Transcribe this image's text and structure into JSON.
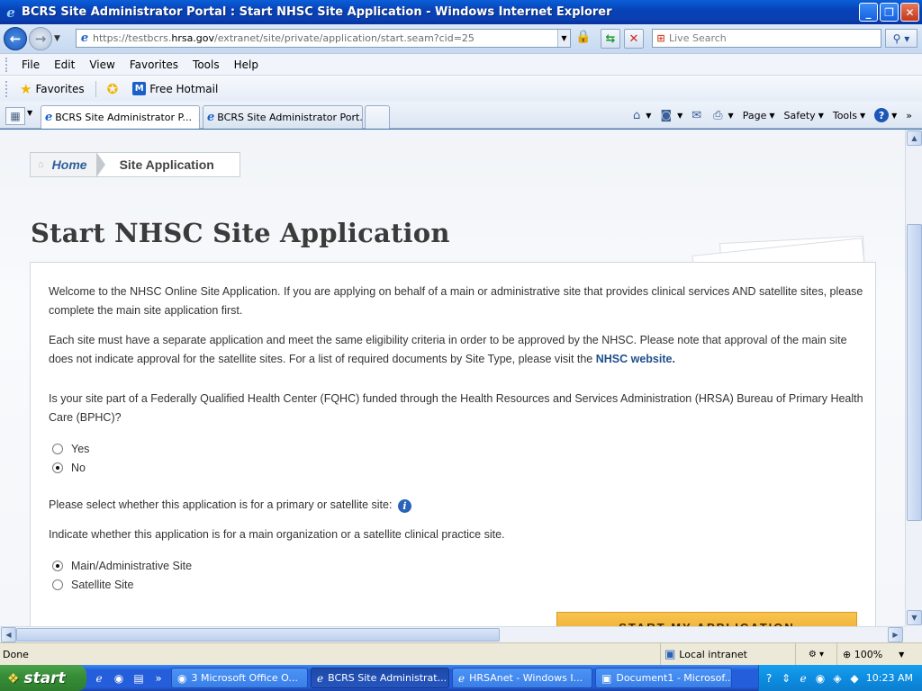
{
  "window": {
    "title": "BCRS Site Administrator Portal : Start NHSC Site Application - Windows Internet Explorer",
    "minimize_glyph": "_",
    "maximize_glyph": "❐",
    "close_glyph": "✕"
  },
  "address_bar": {
    "url_prefix": "https://testbcrs.",
    "url_host": "hrsa.gov",
    "url_path": "/extranet/site/private/application/start.seam?cid=25",
    "search_placeholder": "Live Search"
  },
  "menu": [
    "File",
    "Edit",
    "View",
    "Favorites",
    "Tools",
    "Help"
  ],
  "favorites_bar": {
    "favorites_label": "Favorites",
    "hotmail_label": "Free Hotmail"
  },
  "tabs": [
    {
      "label": "BCRS Site Administrator P...",
      "active": true
    },
    {
      "label": "BCRS Site Administrator Port...",
      "active": false
    }
  ],
  "command_bar": {
    "page_label": "Page",
    "safety_label": "Safety",
    "tools_label": "Tools"
  },
  "breadcrumb": {
    "home_label": "Home",
    "current_label": "Site Application"
  },
  "page": {
    "title": "Start NHSC Site Application",
    "intro_1": "Welcome to the NHSC Online Site Application. If you are applying on behalf of a main or administrative site that provides clinical services AND satellite sites, please complete the main site application first.",
    "intro_2_text": "Each site must have a separate application and meet the same eligibility criteria in order to be approved by the NHSC. Please note that approval of the main site does not indicate approval for the satellite sites. For a list of required documents by Site Type, please visit the ",
    "intro_2_link": "NHSC website.",
    "fqhc_question": "Is your site part of a Federally Qualified Health Center (FQHC) funded through the Health Resources and Services Administration (HRSA) Bureau of Primary Health Care (BPHC)?",
    "fqhc_options": [
      {
        "label": "Yes",
        "selected": false
      },
      {
        "label": "No",
        "selected": true
      }
    ],
    "site_type_prompt": "Please select whether this application is for a primary or satellite site:",
    "site_type_instruction": "Indicate whether this application is for a main organization or a satellite clinical practice site.",
    "site_type_options": [
      {
        "label": "Main/Administrative Site",
        "selected": true
      },
      {
        "label": "Satellite Site",
        "selected": false
      }
    ],
    "start_button_label": "START MY APPLICATION"
  },
  "status_bar": {
    "status_text": "Done",
    "zone": "Local intranet",
    "zoom": "100%"
  },
  "taskbar": {
    "start_label": "start",
    "buttons": [
      {
        "label": "3 Microsoft Office O...",
        "icon": "outlook-icon",
        "active": false
      },
      {
        "label": "BCRS Site Administrat...",
        "icon": "ie-icon",
        "active": true
      },
      {
        "label": "HRSAnet - Windows I...",
        "icon": "ie-icon",
        "active": false
      },
      {
        "label": "Document1 - Microsof...",
        "icon": "word-icon",
        "active": false
      }
    ],
    "clock": "10:23 AM"
  },
  "colors": {
    "ie_blue": "#0a5fd8",
    "link_blue": "#1f4f8c",
    "start_button_orange": "#f1a928",
    "taskbar_blue": "#245edb",
    "start_green": "#388e38"
  }
}
